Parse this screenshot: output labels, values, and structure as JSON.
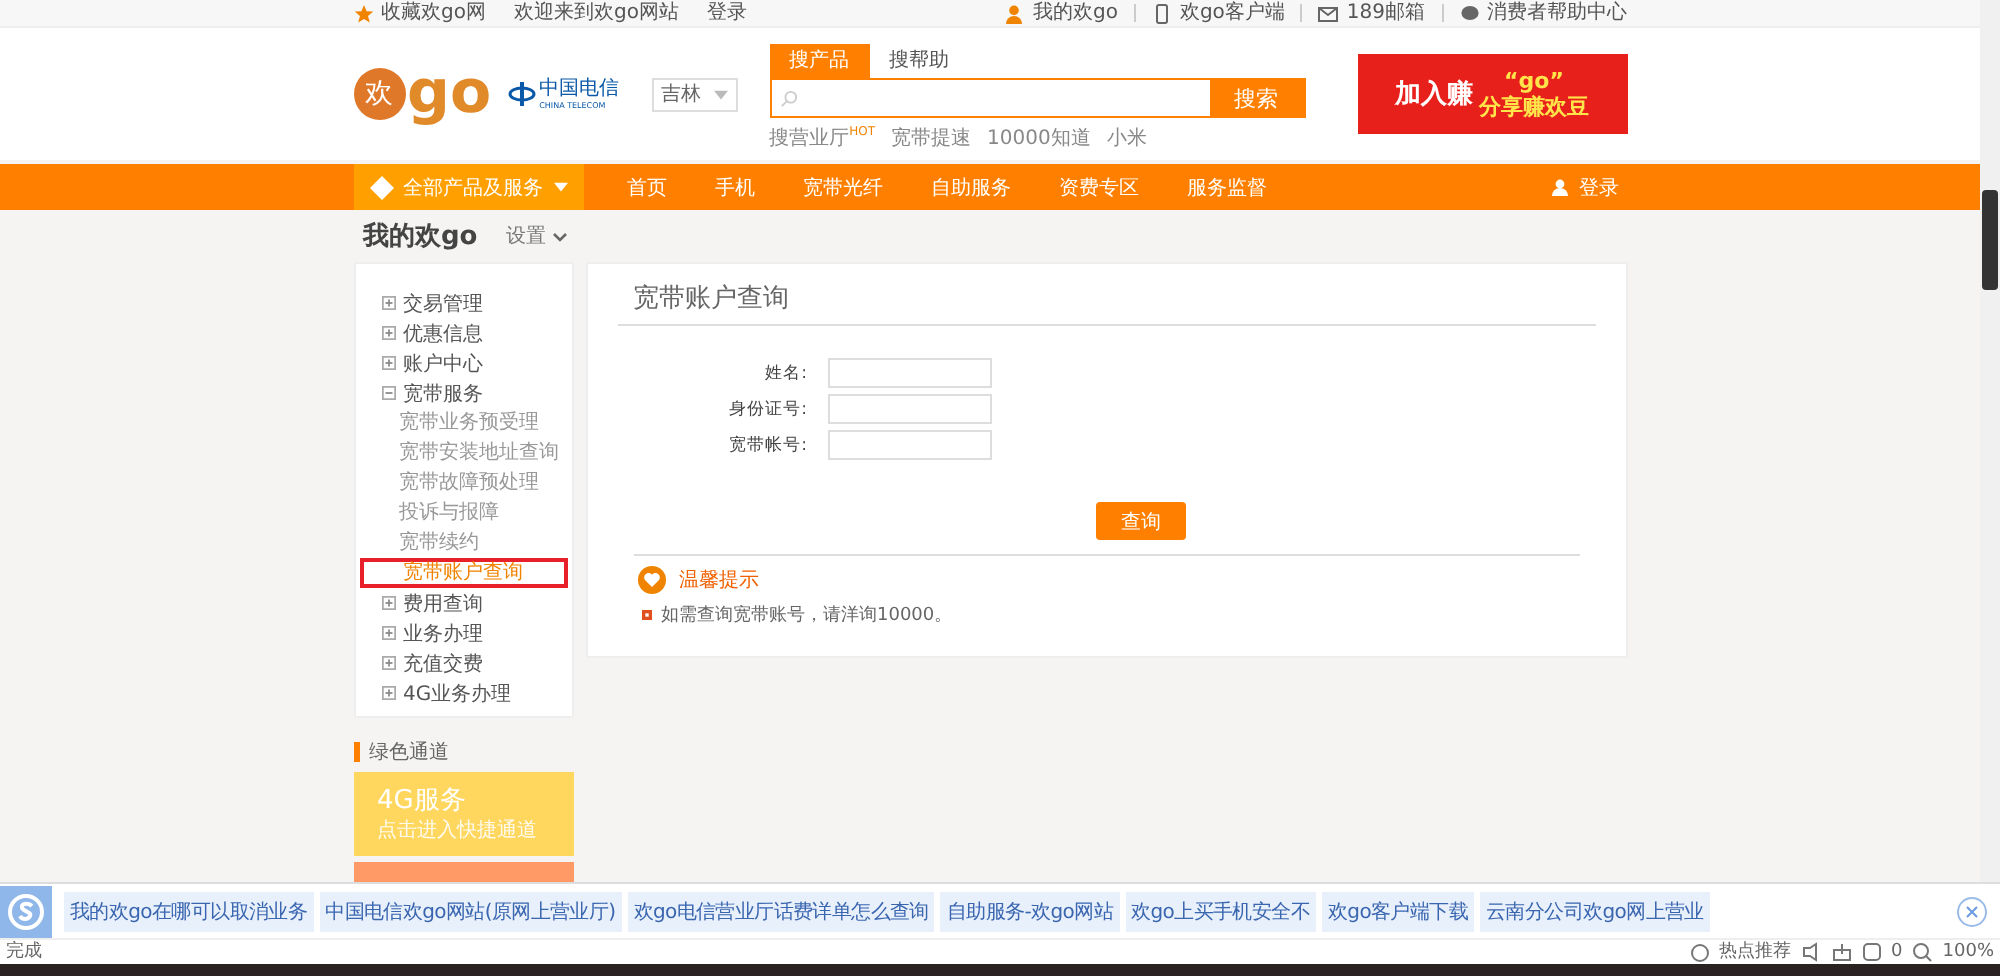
{
  "top_bar": {
    "left": [
      "收藏欢go网",
      "欢迎来到欢go网站",
      "登录"
    ],
    "right": [
      "我的欢go",
      "欢go客户端",
      "189邮箱",
      "消费者帮助中心"
    ]
  },
  "header": {
    "logo": {
      "mark": "欢",
      "word": "go"
    },
    "partner": {
      "name": "中国电信",
      "subtitle": "CHINA TELECOM"
    },
    "region": "吉林",
    "search": {
      "tabs": [
        {
          "label": "搜产品",
          "selected": true
        },
        {
          "label": "搜帮助",
          "selected": false
        }
      ],
      "button": "搜索",
      "hot_links": [
        "搜营业厅$^{HOT}$",
        "宽带提速",
        "10000知道",
        "小米"
      ]
    },
    "banner": {
      "line_1": "加入赚",
      "quote": "“go”",
      "line_2": "分享赚欢豆"
    }
  },
  "nav": {
    "all_products": "全部产品及服务",
    "items": [
      "首页",
      "手机",
      "宽带光纤",
      "自助服务",
      "资费专区",
      "服务监督"
    ],
    "login": "登录"
  },
  "account": {
    "title": "我的欢go",
    "settings": "设置"
  },
  "sidebar": {
    "items": [
      {
        "label": "交易管理",
        "expanded": false
      },
      {
        "label": "优惠信息",
        "expanded": false
      },
      {
        "label": "账户中心",
        "expanded": false
      },
      {
        "label": "宽带服务",
        "expanded": true,
        "children": [
          {
            "label": "宽带业务预受理",
            "selected": false
          },
          {
            "label": "宽带安装地址查询",
            "selected": false
          },
          {
            "label": "宽带故障预处理",
            "selected": false
          },
          {
            "label": "投诉与报障",
            "selected": false
          },
          {
            "label": "宽带续约",
            "selected": false
          },
          {
            "label": "宽带账户查询",
            "selected": true
          }
        ]
      },
      {
        "label": "费用查询",
        "expanded": false
      },
      {
        "label": "业务办理",
        "expanded": false
      },
      {
        "label": "充值交费",
        "expanded": false
      },
      {
        "label": "4G业务办理",
        "expanded": false
      }
    ]
  },
  "form": {
    "title": "宽带账户查询",
    "fields": [
      {
        "label": "姓名:"
      },
      {
        "label": "身份证号:"
      },
      {
        "label": "宽带帐号:"
      }
    ],
    "button": "查询",
    "tip": {
      "title": "温馨提示",
      "text": "如需查询宽带账号，请洋询10000。"
    }
  },
  "green_channel": {
    "title": "绿色通道",
    "cards": [
      {
        "title": "4G服务",
        "subtitle": "点击进入快捷通道",
        "color": "#ffd75e"
      },
      {
        "color": "#ff9966"
      }
    ]
  },
  "toolbar": {
    "chips": [
      "我的欢go在哪可以取消业务",
      "中国电信欢go网站(原网上营业厅)",
      "欢go电信营业厅话费详单怎么查询",
      "自助服务-欢go网站",
      "欢go上买手机安全不",
      "欢go客户端下载",
      "云南分公司欢go网上营业"
    ]
  },
  "status_bar": {
    "text": "完成",
    "hot": "热点推荐",
    "count": "0",
    "zoom": "100%"
  }
}
